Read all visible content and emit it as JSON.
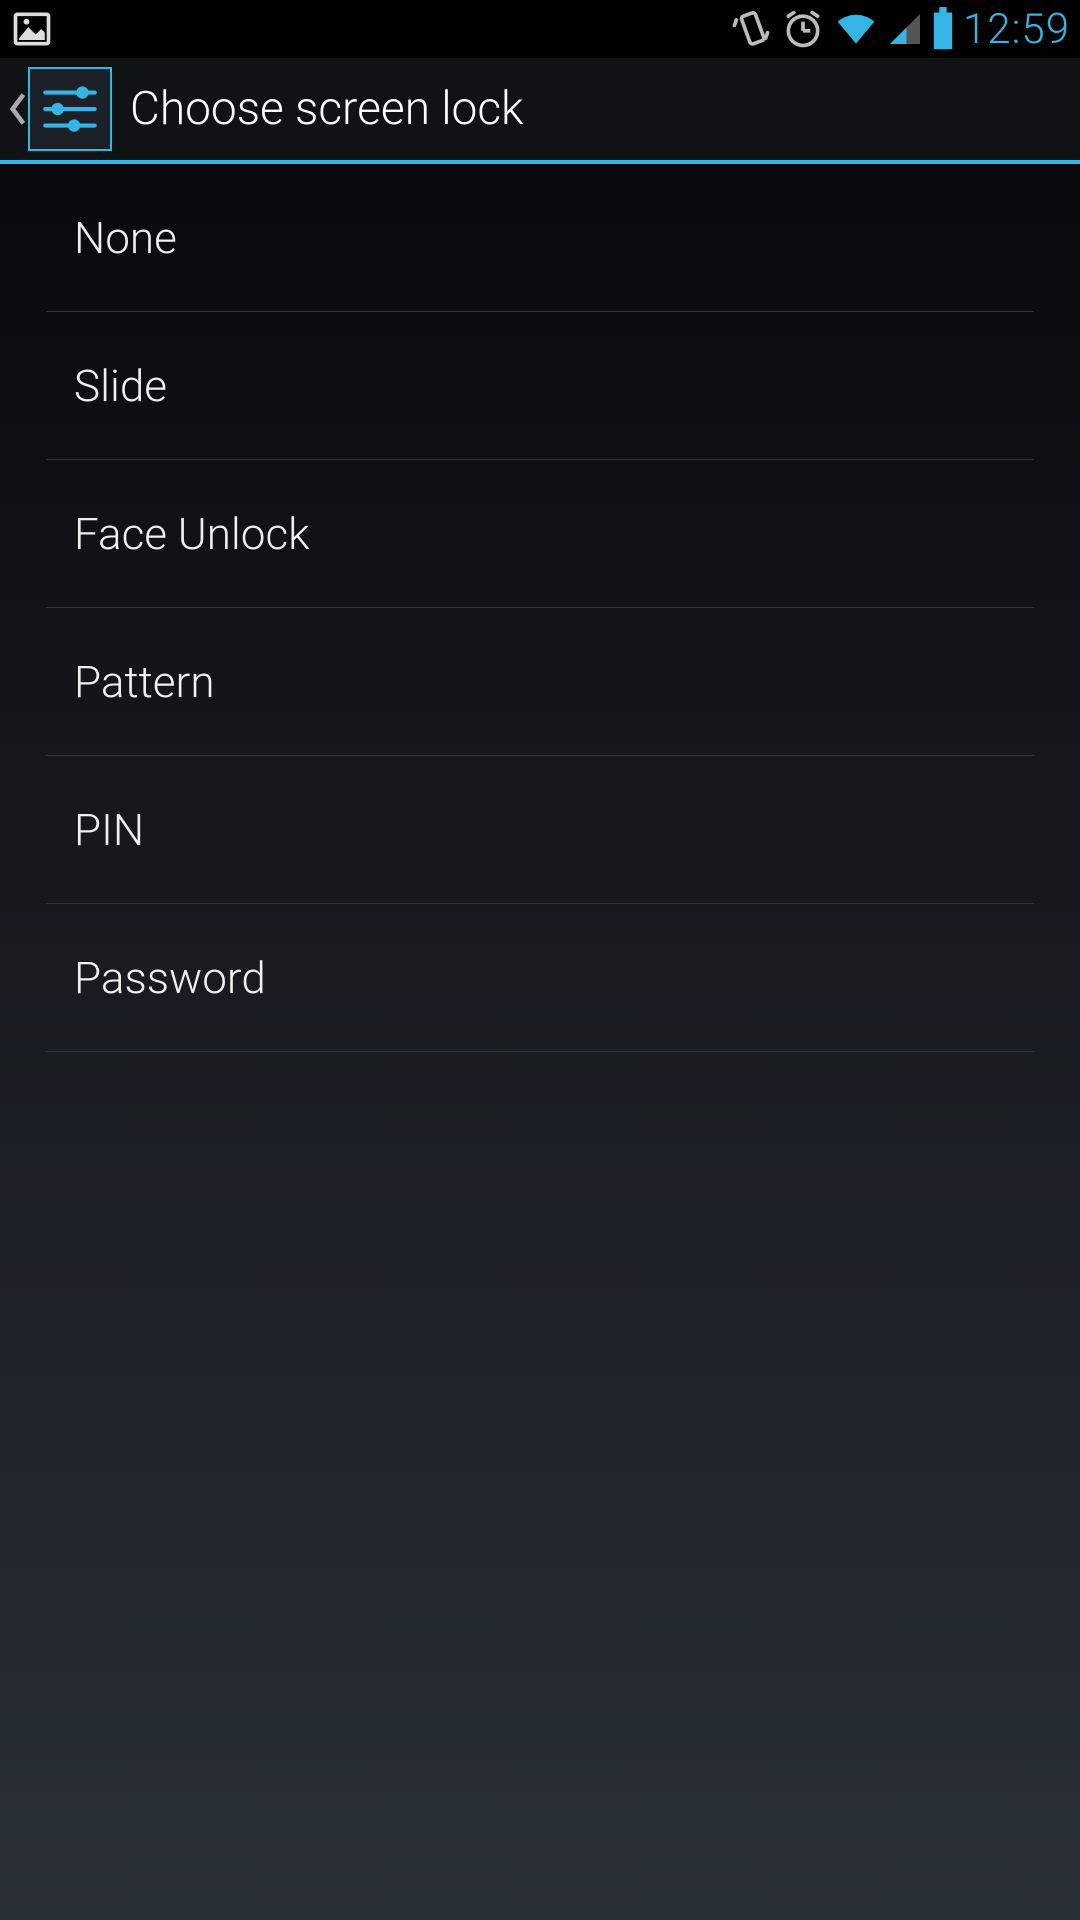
{
  "status": {
    "time": "12:59",
    "colors": {
      "accent": "#33b5e5",
      "text": "#eaeaea"
    }
  },
  "actionbar": {
    "title": "Choose screen lock"
  },
  "options": [
    {
      "label": "None"
    },
    {
      "label": "Slide"
    },
    {
      "label": "Face Unlock"
    },
    {
      "label": "Pattern"
    },
    {
      "label": "PIN"
    },
    {
      "label": "Password"
    }
  ]
}
